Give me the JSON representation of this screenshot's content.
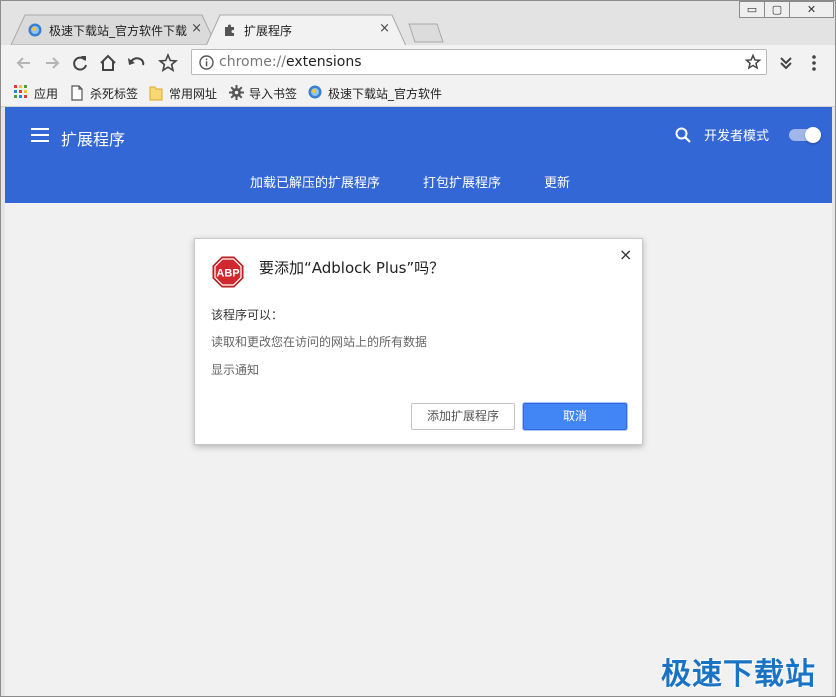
{
  "tabs": [
    {
      "title": "极速下载站_官方软件下载",
      "close": "×",
      "icon": "globe-favicon-icon"
    },
    {
      "title": "扩展程序",
      "close": "×",
      "icon": "puzzle-icon"
    }
  ],
  "window_controls": {
    "minimize": "▭",
    "restore": "▢",
    "close": "✕"
  },
  "omnibox": {
    "scheme": "chrome://",
    "path": "extensions"
  },
  "bookmarks": [
    {
      "label": "应用",
      "icon": "apps-grid-icon"
    },
    {
      "label": "杀死标签",
      "icon": "page-icon"
    },
    {
      "label": "常用网址",
      "icon": "folder-icon"
    },
    {
      "label": "导入书签",
      "icon": "gear-icon"
    },
    {
      "label": "极速下载站_官方软件",
      "icon": "globe-favicon-icon"
    }
  ],
  "header": {
    "title": "扩展程序",
    "dev_mode_label": "开发者模式",
    "dev_mode_on": true,
    "nav": [
      "加载已解压的扩展程序",
      "打包扩展程序",
      "更新"
    ]
  },
  "dialog": {
    "icon_text": "ABP",
    "title": "要添加“Adblock Plus”吗？",
    "close": "×",
    "permissions_heading": "该程序可以：",
    "permissions": [
      "读取和更改您在访问的网站上的所有数据",
      "显示通知"
    ],
    "add_button": "添加扩展程序",
    "cancel_button": "取消"
  },
  "watermark": "极速下载站",
  "colors": {
    "header": "#3367d6",
    "primary_button": "#4285f4",
    "abp_red": "#d0282c"
  }
}
